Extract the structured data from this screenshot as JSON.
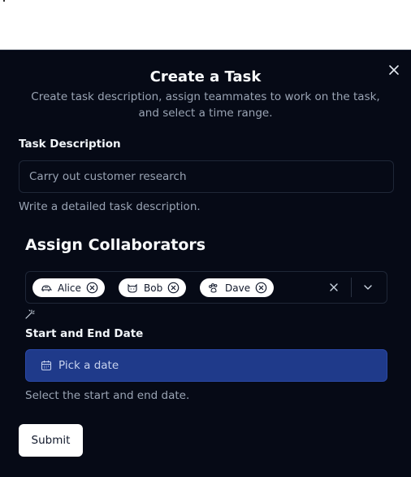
{
  "dialog": {
    "title": "Create a Task",
    "subtitle": "Create task description, assign teammates to work on the task, and select a time range.",
    "close_icon": "close-icon"
  },
  "task_description": {
    "label": "Task Description",
    "placeholder": "Carry out customer research",
    "help": "Write a detailed task description."
  },
  "collaborators": {
    "title": "Assign Collaborators",
    "selected": [
      {
        "label": "Alice",
        "icon": "turtle-icon"
      },
      {
        "label": "Bob",
        "icon": "cat-icon"
      },
      {
        "label": "Dave",
        "icon": "dog-icon"
      }
    ],
    "clear_icon": "clear-icon",
    "dropdown_icon": "chevron-down-icon",
    "below_icon": "magic-wand-icon"
  },
  "date_range": {
    "label": "Start and End Date",
    "button_label": "Pick a date",
    "icon": "calendar-icon",
    "help": "Select the start and end date."
  },
  "submit_label": "Submit",
  "colors": {
    "background": "#060a16",
    "date_button": "#1f3a8a",
    "muted_text": "#9aa4b4"
  }
}
